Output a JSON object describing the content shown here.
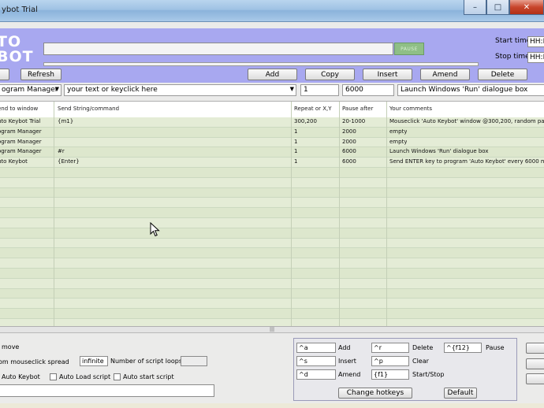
{
  "window": {
    "title": "ybot Trial",
    "controls": {
      "minimize": "–",
      "maximize": "□",
      "close": "✕"
    }
  },
  "header": {
    "logo_line1": "TO",
    "logo_line2": "BOT",
    "pause_label": "PAUSE",
    "progress": 0.0,
    "start_time_label": "Start time",
    "start_time_value": "HH:MM",
    "stop_time_label": "Stop time",
    "stop_time_value": "HH:MM",
    "accent": "#a8a8f0"
  },
  "toolbar": {
    "left_partial_label": "",
    "refresh_label": "Refresh",
    "add_label": "Add",
    "copy_label": "Copy",
    "insert_label": "Insert",
    "amend_label": "Amend",
    "delete_label": "Delete"
  },
  "inputs": {
    "window_select": "ogram Manager",
    "command_select": "your text or keyclick here",
    "repeat": "1",
    "pause": "6000",
    "comment": "Launch Windows 'Run' dialogue box"
  },
  "grid": {
    "headers": [
      "end to window",
      "Send String/command",
      "Repeat or X,Y",
      "Pause after",
      "Your comments"
    ],
    "rows": [
      [
        "uto Keybot Trial",
        "{m1}",
        "300,200",
        "20-1000",
        "Mouseclick 'Auto Keybot' window @300,200, random paus"
      ],
      [
        "ogram Manager",
        "",
        "1",
        "2000",
        "empty"
      ],
      [
        "ogram Manager",
        "",
        "1",
        "2000",
        "empty"
      ],
      [
        "ogram Manager",
        "#r",
        "1",
        "6000",
        "Launch Windows 'Run' dialogue box"
      ],
      [
        "uto Keybot",
        "{Enter}",
        "1",
        "6000",
        "Send ENTER key to program 'Auto Keybot' every 6000 m"
      ]
    ],
    "empty_rows": 16,
    "splitter_glyph": "|||"
  },
  "bottom_left": {
    "move_label": "move",
    "spread_label": "om mouseclick spread",
    "loops_value": "infinite",
    "loops_label": "Number of script loops",
    "auto_keybot_label": "Auto Keybot",
    "auto_load_label": "Auto Load script",
    "auto_start_label": "Auto start script"
  },
  "hotkeys": {
    "add_key": "^a",
    "add_label": "Add",
    "delete_key": "^r",
    "delete_label": "Delete",
    "pause_key": "^{f12}",
    "pause_label": "Pause",
    "insert_key": "^s",
    "insert_label": "Insert",
    "clear_key": "^p",
    "clear_label": "Clear",
    "amend_key": "^d",
    "amend_label": "Amend",
    "startstop_key": "{f1}",
    "startstop_label": "Start/Stop",
    "change_label": "Change hotkeys",
    "default_label": "Default"
  }
}
